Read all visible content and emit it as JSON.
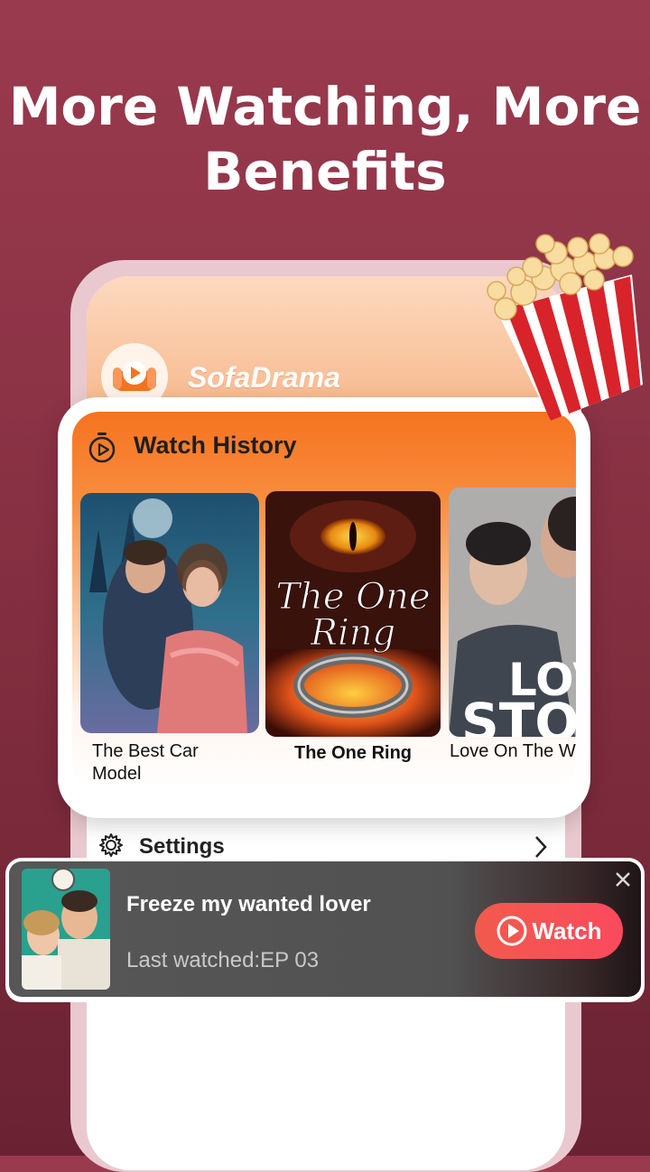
{
  "headline": {
    "line1": "More  Watching, More",
    "line2": "Benefits"
  },
  "app": {
    "name": "SofaDrama",
    "logo_icon": "sofa-play-icon",
    "accent": "#f5731f"
  },
  "watch_history": {
    "title": "Watch History",
    "icon": "timer-play-icon",
    "items": [
      {
        "caption": "The Best Car Model",
        "caption_line1": "The Best Car",
        "caption_line2": "Model"
      },
      {
        "caption": "The One Ring",
        "poster_text": "The One Ring"
      },
      {
        "caption": "Love On The W",
        "poster_text": "LOVE STOR"
      }
    ]
  },
  "settings": {
    "label": "Settings",
    "icon": "gear-icon"
  },
  "mini_player": {
    "title": "Freeze my  wanted lover",
    "subtitle": "Last watched:EP 03",
    "button_label": "Watch",
    "close_icon": "close-icon",
    "button_color": "#f25a4c"
  }
}
